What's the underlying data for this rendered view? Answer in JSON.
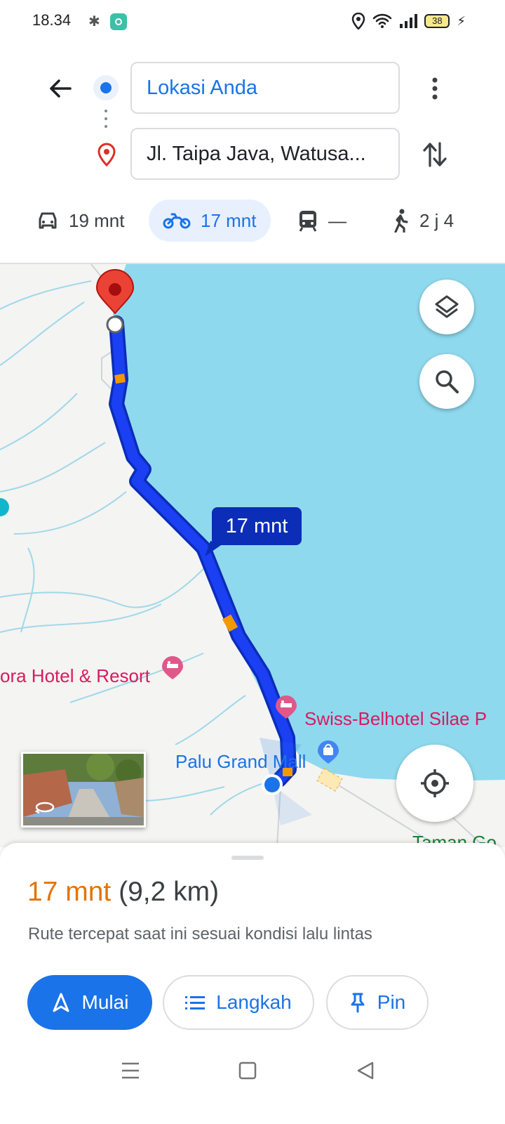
{
  "status_bar": {
    "time": "18.34",
    "battery": "38"
  },
  "header": {
    "origin": "Lokasi Anda",
    "destination": "Jl. Taipa Java, Watusa..."
  },
  "modes": [
    {
      "name": "car",
      "label": "19 mnt"
    },
    {
      "name": "motorbike",
      "label": "17 mnt",
      "active": true
    },
    {
      "name": "transit",
      "label": "—"
    },
    {
      "name": "walk",
      "label": "2 j 4"
    }
  ],
  "map": {
    "eta_label": "17 mnt",
    "pois": {
      "hotel_left": "ora Hotel & Resort",
      "hotel_right": "Swiss-Belhotel Silae P",
      "mall": "Palu Grand Mall",
      "park": "Taman Go"
    },
    "route_color": "#1b3ff2",
    "water_color": "#8fd9ee"
  },
  "sheet": {
    "duration": "17 mnt",
    "distance": "(9,2 km)",
    "note": "Rute tercepat saat ini sesuai kondisi lalu lintas",
    "buttons": {
      "start": "Mulai",
      "steps": "Langkah",
      "pin": "Pin"
    }
  }
}
